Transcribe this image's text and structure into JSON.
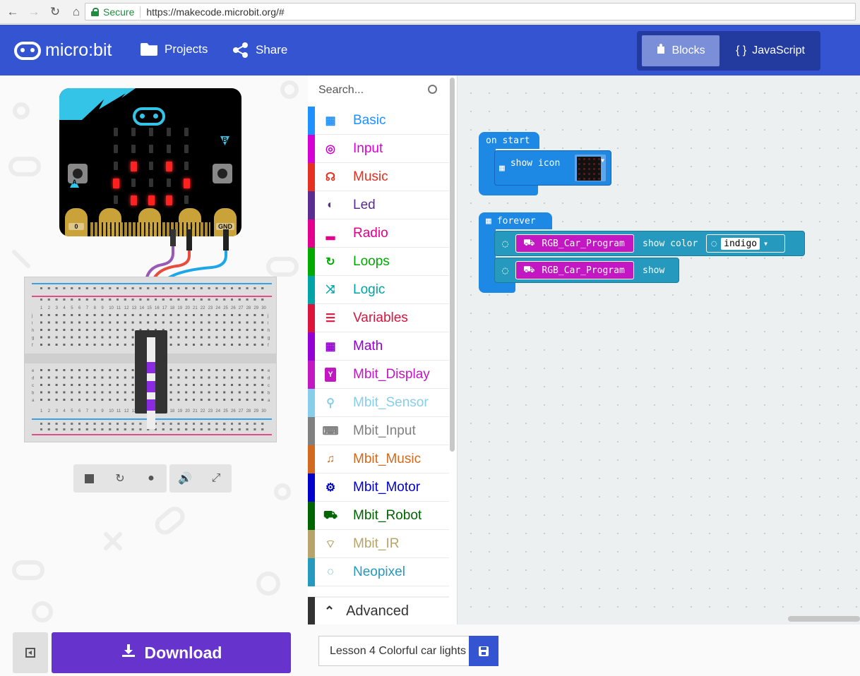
{
  "browser": {
    "secure_label": "Secure",
    "url": "https://makecode.microbit.org/#"
  },
  "header": {
    "logo_text": "micro:bit",
    "projects_label": "Projects",
    "share_label": "Share",
    "blocks_label": "Blocks",
    "javascript_label": "JavaScript",
    "active_editor": "Blocks",
    "accent_color": "#3454d1"
  },
  "simulator": {
    "pin_labels": [
      "0",
      "1",
      "2",
      "3V",
      "GND"
    ],
    "button_a_label": "A",
    "button_b_label": "B",
    "breadboard_column_numbers": [
      "1",
      "2",
      "3",
      "4",
      "5",
      "6",
      "7",
      "8",
      "9",
      "10",
      "11",
      "12",
      "13",
      "14",
      "15",
      "16",
      "17",
      "18",
      "19",
      "20",
      "21",
      "22",
      "23",
      "24",
      "25",
      "26",
      "27",
      "28",
      "29",
      "30"
    ],
    "breadboard_row_letters_top": [
      "j",
      "i",
      "h",
      "g",
      "f"
    ],
    "breadboard_row_letters_bottom": [
      "e",
      "d",
      "c",
      "b",
      "a"
    ],
    "controls": [
      "stop-icon",
      "restart-icon",
      "slow-mo-icon",
      "mute-icon",
      "fullscreen-icon"
    ]
  },
  "toolbox": {
    "search_placeholder": "Search...",
    "categories": [
      {
        "label": "Basic",
        "color": "#1e90ff",
        "icon": "grid-icon"
      },
      {
        "label": "Input",
        "color": "#d400d4",
        "icon": "target-icon"
      },
      {
        "label": "Music",
        "color": "#e63022",
        "icon": "headphones-icon"
      },
      {
        "label": "Led",
        "color": "#5c2d91",
        "icon": "toggle-icon"
      },
      {
        "label": "Radio",
        "color": "#e3008c",
        "icon": "signal-bars-icon"
      },
      {
        "label": "Loops",
        "color": "#00aa00",
        "icon": "refresh-icon"
      },
      {
        "label": "Logic",
        "color": "#00a4a6",
        "icon": "shuffle-icon"
      },
      {
        "label": "Variables",
        "color": "#dc143c",
        "icon": "list-icon"
      },
      {
        "label": "Math",
        "color": "#9400d3",
        "icon": "calculator-icon"
      },
      {
        "label": "Mbit_Display",
        "color": "#c217c2",
        "icon": "y-badge-icon"
      },
      {
        "label": "Mbit_Sensor",
        "color": "#87ceeb",
        "icon": "wrench-icon"
      },
      {
        "label": "Mbit_Input",
        "color": "#808080",
        "icon": "keyboard-icon"
      },
      {
        "label": "Mbit_Music",
        "color": "#d2691e",
        "icon": "music-note-icon"
      },
      {
        "label": "Mbit_Motor",
        "color": "#0000cd",
        "icon": "gear-icon"
      },
      {
        "label": "Mbit_Robot",
        "color": "#006400",
        "icon": "car-icon"
      },
      {
        "label": "Mbit_IR",
        "color": "#b8a46a",
        "icon": "wifi-icon"
      },
      {
        "label": "Neopixel",
        "color": "#2699bf",
        "icon": "ring-icon"
      }
    ],
    "advanced_label": "Advanced"
  },
  "workspace": {
    "on_start": {
      "hat_label": "on start",
      "show_icon_label": "show icon"
    },
    "forever": {
      "hat_label": "forever",
      "row1_block": "RGB_Car_Program",
      "row1_action": "show color",
      "row1_value": "indigo",
      "row2_block": "RGB_Car_Program",
      "row2_action": "show"
    }
  },
  "footer": {
    "download_label": "Download",
    "project_name": "Lesson 4 Colorful car lights"
  }
}
